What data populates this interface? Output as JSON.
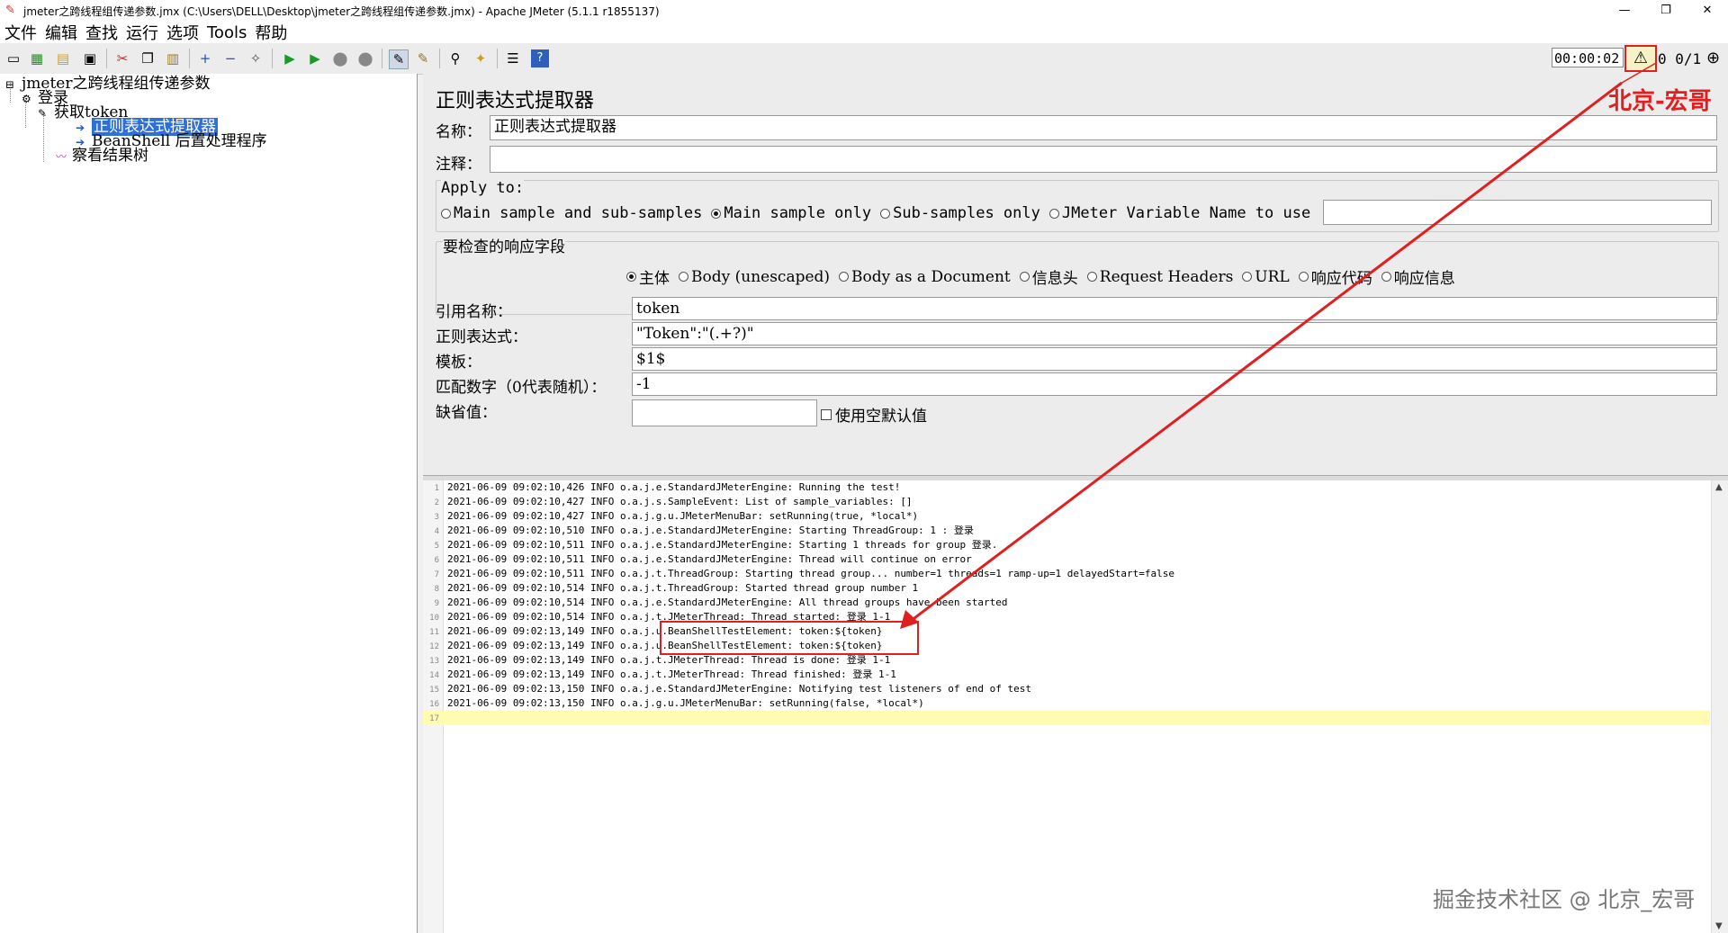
{
  "window": {
    "title": "jmeter之跨线程组传递参数.jmx (C:\\Users\\DELL\\Desktop\\jmeter之跨线程组传递参数.jmx) - Apache JMeter (5.1.1 r1855137)",
    "minimize": "—",
    "restore": "❐",
    "close": "✕"
  },
  "menu": [
    "文件",
    "编辑",
    "查找",
    "运行",
    "选项",
    "Tools",
    "帮助"
  ],
  "toolbar": {
    "timer": "00:00:02",
    "warnings": "0",
    "threads": "0/1"
  },
  "tree": {
    "root": "jmeter之跨线程组传递参数",
    "group": "登录",
    "sampler": "获取token",
    "extractor": "正则表达式提取器",
    "postproc": "BeanShell 后置处理程序",
    "listener": "察看结果树"
  },
  "panel": {
    "title": "正则表达式提取器",
    "name_label": "名称：",
    "name_value": "正则表达式提取器",
    "comment_label": "注释：",
    "comment_value": "",
    "apply_to": {
      "title": "Apply to:",
      "options": [
        "Main sample and sub-samples",
        "Main sample only",
        "Sub-samples only",
        "JMeter Variable Name to use"
      ],
      "selected": 1,
      "variable_value": ""
    },
    "field_check": {
      "title": "要检查的响应字段",
      "options": [
        "主体",
        "Body (unescaped)",
        "Body as a Document",
        "信息头",
        "Request Headers",
        "URL",
        "响应代码",
        "响应信息"
      ],
      "selected": 0
    },
    "ref_name_label": "引用名称：",
    "ref_name_value": "token",
    "regex_label": "正则表达式：",
    "regex_value": "\"Token\":\"(.+?)\"",
    "template_label": "模板：",
    "template_value": "$1$",
    "match_label": "匹配数字（0代表随机）：",
    "match_value": "-1",
    "default_label": "缺省值：",
    "default_value": "",
    "empty_default_label": "使用空默认值"
  },
  "annotation": {
    "author": "北京-宏哥"
  },
  "log": [
    {
      "n": "1",
      "text": "2021-06-09 09:02:10,426 INFO o.a.j.e.StandardJMeterEngine: Running the test!"
    },
    {
      "n": "2",
      "text": "2021-06-09 09:02:10,427 INFO o.a.j.s.SampleEvent: List of sample_variables: []"
    },
    {
      "n": "3",
      "text": "2021-06-09 09:02:10,427 INFO o.a.j.g.u.JMeterMenuBar: setRunning(true, *local*)"
    },
    {
      "n": "4",
      "text": "2021-06-09 09:02:10,510 INFO o.a.j.e.StandardJMeterEngine: Starting ThreadGroup: 1 : 登录"
    },
    {
      "n": "5",
      "text": "2021-06-09 09:02:10,511 INFO o.a.j.e.StandardJMeterEngine: Starting 1 threads for group 登录."
    },
    {
      "n": "6",
      "text": "2021-06-09 09:02:10,511 INFO o.a.j.e.StandardJMeterEngine: Thread will continue on error"
    },
    {
      "n": "7",
      "text": "2021-06-09 09:02:10,511 INFO o.a.j.t.ThreadGroup: Starting thread group... number=1 threads=1 ramp-up=1 delayedStart=false"
    },
    {
      "n": "8",
      "text": "2021-06-09 09:02:10,514 INFO o.a.j.t.ThreadGroup: Started thread group number 1"
    },
    {
      "n": "9",
      "text": "2021-06-09 09:02:10,514 INFO o.a.j.e.StandardJMeterEngine: All thread groups have been started"
    },
    {
      "n": "10",
      "text": "2021-06-09 09:02:10,514 INFO o.a.j.t.JMeterThread: Thread started: 登录 1-1"
    },
    {
      "n": "11",
      "text": "2021-06-09 09:02:13,149 INFO o.a.j.u.BeanShellTestElement: token:${token}"
    },
    {
      "n": "12",
      "text": "2021-06-09 09:02:13,149 INFO o.a.j.u.BeanShellTestElement: token:${token}"
    },
    {
      "n": "13",
      "text": "2021-06-09 09:02:13,149 INFO o.a.j.t.JMeterThread: Thread is done: 登录 1-1"
    },
    {
      "n": "14",
      "text": "2021-06-09 09:02:13,149 INFO o.a.j.t.JMeterThread: Thread finished: 登录 1-1"
    },
    {
      "n": "15",
      "text": "2021-06-09 09:02:13,150 INFO o.a.j.e.StandardJMeterEngine: Notifying test listeners of end of test"
    },
    {
      "n": "16",
      "text": "2021-06-09 09:02:13,150 INFO o.a.j.g.u.JMeterMenuBar: setRunning(false, *local*)"
    },
    {
      "n": "17",
      "text": ""
    }
  ],
  "watermark": "掘金技术社区 @ 北京_宏哥",
  "colors": {
    "annotation": "#e02020",
    "selection": "#2f6fd6",
    "current_line": "#fffbb0"
  }
}
